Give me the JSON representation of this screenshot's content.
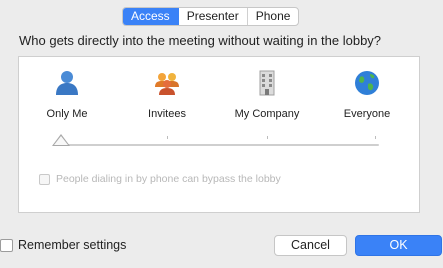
{
  "tabs": [
    {
      "label": "Access",
      "active": true
    },
    {
      "label": "Presenter",
      "active": false
    },
    {
      "label": "Phone",
      "active": false
    }
  ],
  "question": "Who gets directly into the meeting without waiting in the lobby?",
  "options": [
    {
      "label": "Only Me",
      "icon": "person-icon"
    },
    {
      "label": "Invitees",
      "icon": "group-icon"
    },
    {
      "label": "My Company",
      "icon": "building-icon"
    },
    {
      "label": "Everyone",
      "icon": "globe-icon"
    }
  ],
  "slider": {
    "selected_index": 0,
    "steps": 4
  },
  "bypass_label": "People dialing in by phone can bypass the lobby",
  "remember_label": "Remember settings",
  "buttons": {
    "cancel": "Cancel",
    "ok": "OK"
  },
  "colors": {
    "accent": "#3a82f7",
    "background": "#ececec",
    "panel": "#ffffff"
  }
}
